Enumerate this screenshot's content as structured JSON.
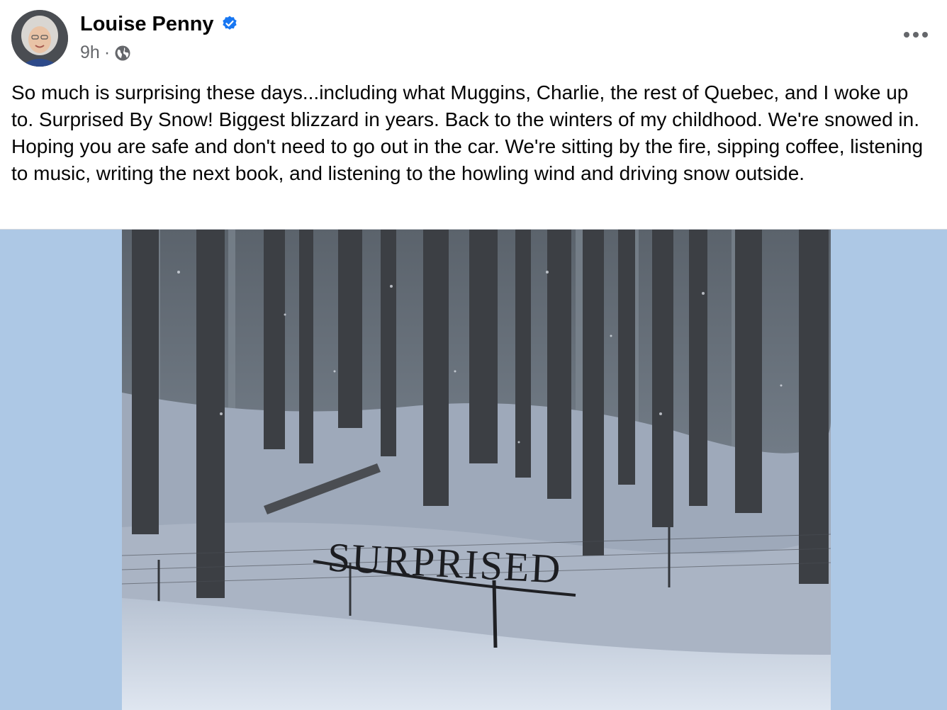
{
  "post": {
    "author": "Louise Penny",
    "timestamp": "9h",
    "separator": "·",
    "text": "So much is surprising these days...including what Muggins, Charlie, the rest of Quebec, and I woke up to.  Surprised By Snow!  Biggest blizzard in years.  Back to the winters of my childhood.  We're snowed in. Hoping you are safe and don't need to go out in the car.  We're sitting by the fire, sipping coffee, listening to music, writing the next book, and listening to the howling wind and driving snow outside.",
    "image": {
      "sign_text": "SURPRISED"
    }
  },
  "icons": {
    "verified": "verified-badge-icon",
    "audience": "globe-icon",
    "more": "more-options-icon"
  },
  "colors": {
    "verified_blue": "#1877f2",
    "secondary_text": "#65676b",
    "media_background": "#adc8e5"
  }
}
